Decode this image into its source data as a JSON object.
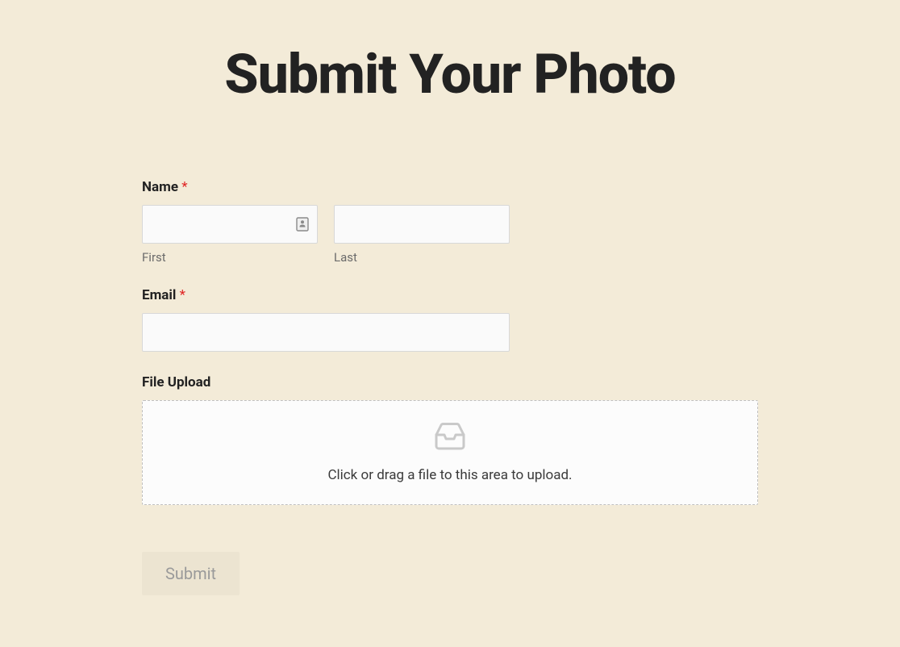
{
  "page": {
    "title": "Submit Your Photo"
  },
  "form": {
    "name": {
      "label": "Name",
      "required_mark": "*",
      "first": {
        "value": "",
        "sub_label": "First"
      },
      "last": {
        "value": "",
        "sub_label": "Last"
      }
    },
    "email": {
      "label": "Email",
      "required_mark": "*",
      "value": ""
    },
    "file_upload": {
      "label": "File Upload",
      "dropzone_text": "Click or drag a file to this area to upload."
    },
    "submit": {
      "label": "Submit"
    }
  }
}
